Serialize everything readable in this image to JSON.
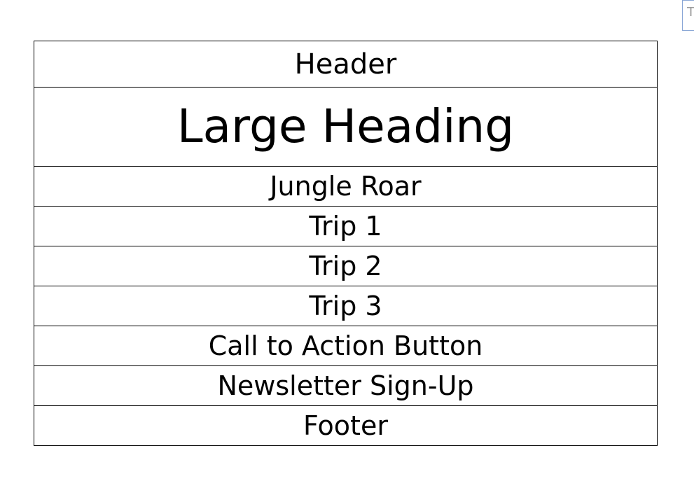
{
  "corner_element": {
    "text": "T"
  },
  "wireframe": {
    "rows": [
      {
        "label": "Header"
      },
      {
        "label": "Large Heading"
      },
      {
        "label": "Jungle Roar"
      },
      {
        "label": "Trip 1"
      },
      {
        "label": "Trip 2"
      },
      {
        "label": "Trip 3"
      },
      {
        "label": "Call to Action Button"
      },
      {
        "label": "Newsletter Sign-Up"
      },
      {
        "label": "Footer"
      }
    ]
  }
}
